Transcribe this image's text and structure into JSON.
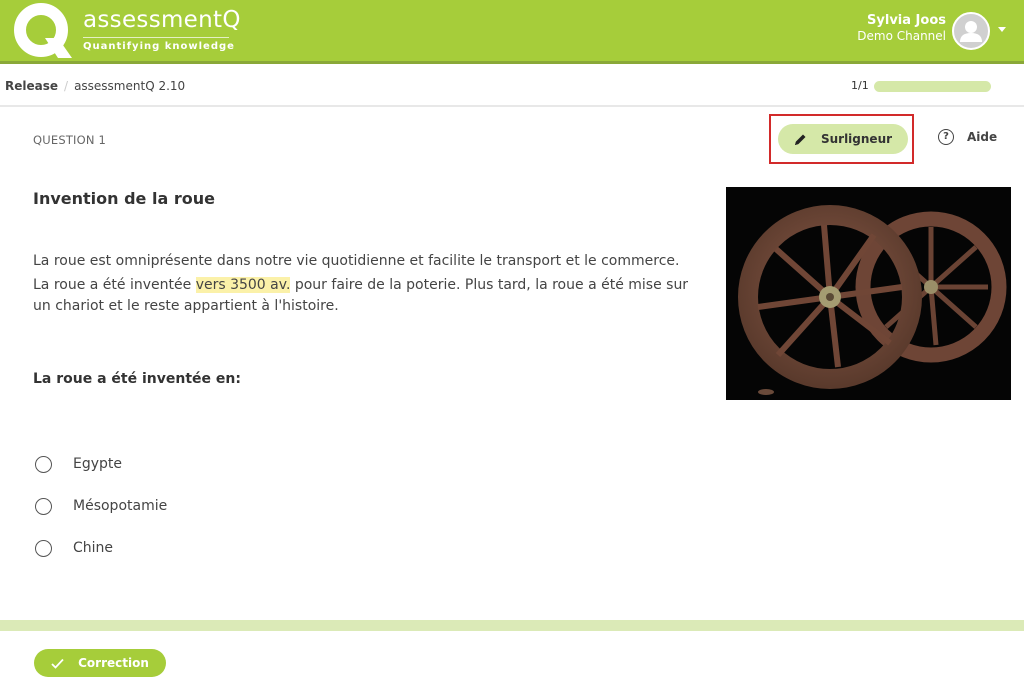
{
  "header": {
    "brand_name": "assessmentQ",
    "brand_tagline": "Quantifying knowledge",
    "user_name": "Sylvia Joos",
    "user_channel": "Demo Channel",
    "accent_color": "#a6cd3a"
  },
  "breadcrumb": {
    "root": "Release",
    "current": "assessmentQ 2.10"
  },
  "progress": {
    "label": "1/1",
    "fraction": 1.0
  },
  "question": {
    "number_label": "QUESTION 1",
    "title": "Invention de la roue",
    "paragraph1": "La roue est omniprésente dans notre vie quotidienne et facilite le transport et le commerce.",
    "paragraph2_before": "La roue a été inventée ",
    "paragraph2_highlight": "vers 3500 av.",
    "paragraph2_after": " pour faire de la poterie. Plus tard, la roue a été mise sur un chariot et le reste appartient à l'histoire.",
    "prompt": "La roue a été inventée en:",
    "options": [
      {
        "label": "Egypte",
        "selected": false
      },
      {
        "label": "Mésopotamie",
        "selected": false
      },
      {
        "label": "Chine",
        "selected": false
      }
    ],
    "image_alt": "Deux roues anciennes"
  },
  "toolbar": {
    "highlighter_label": "Surligneur",
    "help_label": "Aide",
    "help_glyph": "?"
  },
  "footer": {
    "correction_label": "Correction"
  }
}
